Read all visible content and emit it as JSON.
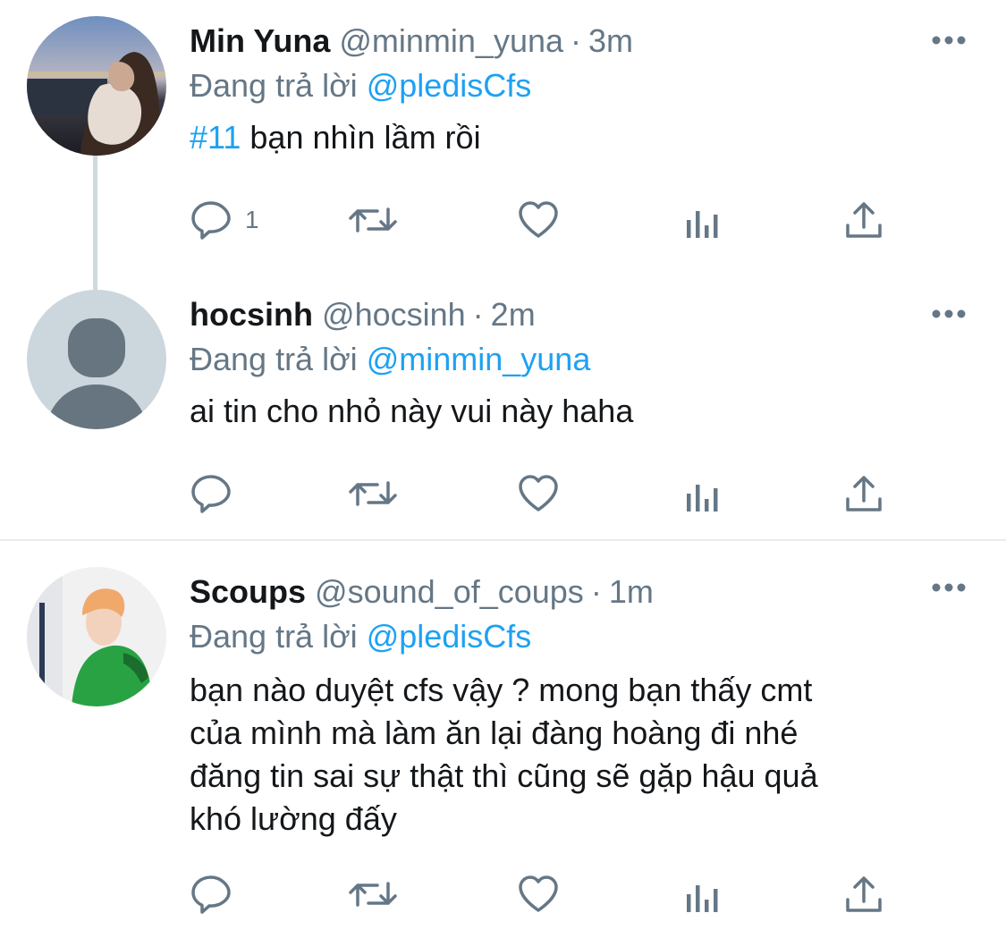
{
  "tweets": [
    {
      "name": "Min Yuna",
      "handle": "@minmin_yuna",
      "separator": "·",
      "time": "3m",
      "reply_prefix": "Đang trả lời",
      "reply_to": "@pledisCfs",
      "hashtag": "#11",
      "text_lines": [
        " bạn nhìn lầm rồi"
      ],
      "reply_count": "1",
      "avatar": "photo"
    },
    {
      "name": "hocsinh",
      "handle": "@hocsinh",
      "separator": "·",
      "time": "2m",
      "reply_prefix": "Đang trả lời",
      "reply_to": "@minmin_yuna",
      "text_lines": [
        "ai tin cho nhỏ này vui này haha"
      ],
      "avatar": "default-profile"
    },
    {
      "name": "Scoups",
      "handle": "@sound_of_coups",
      "separator": "·",
      "time": "1m",
      "reply_prefix": "Đang trả lời",
      "reply_to": "@pledisCfs",
      "text_lines": [
        "bạn nào duyệt cfs vậy ? mong bạn thấy cmt",
        "của mình mà làm ăn lại đàng hoàng đi nhé",
        "đăng tin sai sự thật thì cũng sẽ gặp hậu quả",
        "khó lường đấy"
      ],
      "avatar": "photo"
    }
  ],
  "icons": {
    "reply": "reply-icon",
    "retweet": "retweet-icon",
    "like": "like-icon",
    "stats": "stats-icon",
    "share": "share-icon",
    "more": "more-icon"
  },
  "colors": {
    "text": "#14171a",
    "secondary": "#657786",
    "link": "#1da1f2",
    "thread_line": "#cfd9de",
    "divider": "#e6ecf0"
  }
}
